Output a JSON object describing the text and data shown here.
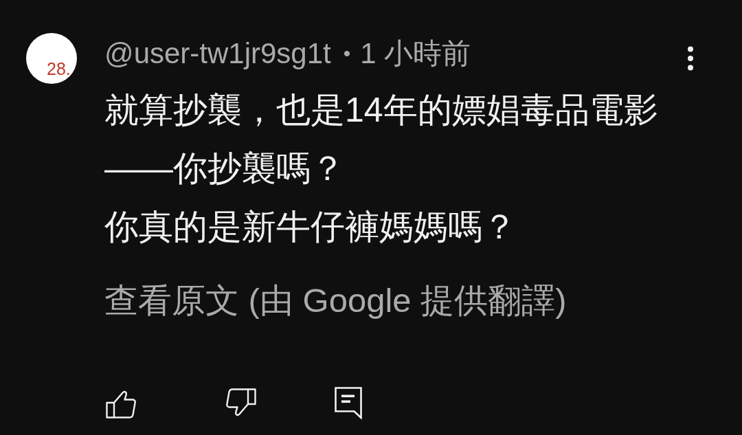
{
  "avatar": {
    "text": "28."
  },
  "comment": {
    "author": "@user-tw1jr9sg1t",
    "separator": "•",
    "time": "1 小時前",
    "paragraphs": [
      "就算抄襲，也是14年的嫖娼毒品電影——你抄襲嗎？",
      "你真的是新牛仔褲媽媽嗎？"
    ],
    "translation_link": "查看原文 (由 Google 提供翻譯)"
  },
  "actions": [
    {
      "kind": "like"
    },
    {
      "kind": "dislike"
    },
    {
      "kind": "reply"
    }
  ]
}
